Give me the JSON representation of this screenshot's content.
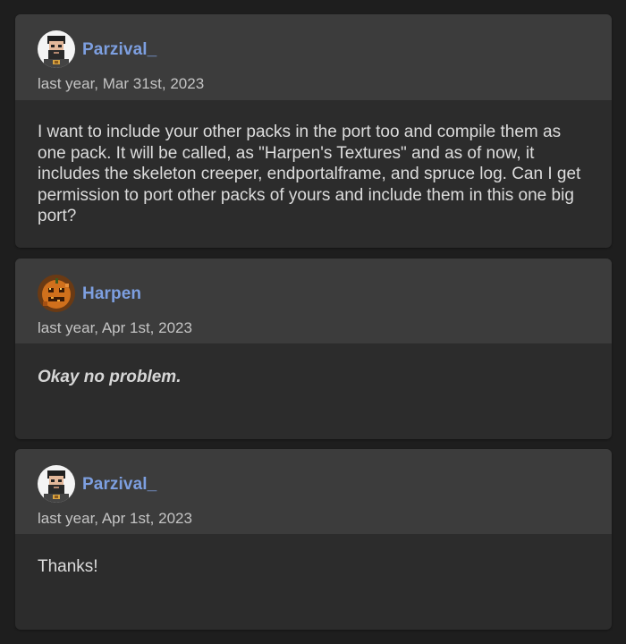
{
  "comments": [
    {
      "author": "Parzival_",
      "avatar": "bearded-man-avatar",
      "timestamp": "last year, Mar 31st, 2023",
      "message": "I want to include your other packs in the port too and compile them as one pack. It will be called, as \"Harpen's Textures\" and as of now, it includes the skeleton creeper, endportalframe, and spruce log. Can I get permission to port other packs of yours and include them in this one big port?"
    },
    {
      "author": "Harpen",
      "avatar": "pumpkin-avatar",
      "timestamp": "last year, Apr 1st, 2023",
      "message": "Okay no problem."
    },
    {
      "author": "Parzival_",
      "avatar": "bearded-man-avatar",
      "timestamp": "last year, Apr 1st, 2023",
      "message": "Thanks!"
    }
  ],
  "colors": {
    "page_bg": "#1e1e1e",
    "card_header_bg": "#3c3c3c",
    "card_body_bg": "#2c2c2c",
    "author_link": "#7d9fe0",
    "body_text": "#dcdcdc",
    "timestamp_text": "#c4c4c4"
  }
}
